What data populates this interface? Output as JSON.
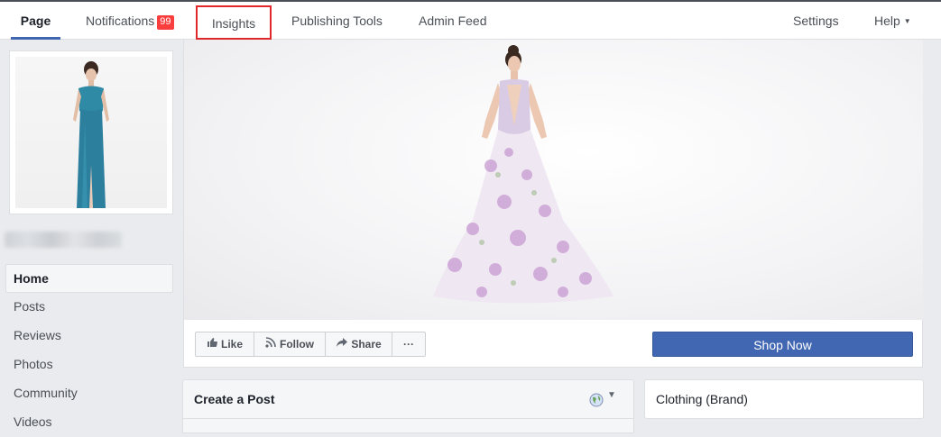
{
  "nav": {
    "page": "Page",
    "notifications": "Notifications",
    "notifications_count": "99",
    "insights": "Insights",
    "publishing_tools": "Publishing Tools",
    "admin_feed": "Admin Feed",
    "settings": "Settings",
    "help": "Help"
  },
  "sidebar": {
    "items": [
      {
        "label": "Home"
      },
      {
        "label": "Posts"
      },
      {
        "label": "Reviews"
      },
      {
        "label": "Photos"
      },
      {
        "label": "Community"
      },
      {
        "label": "Videos"
      }
    ]
  },
  "actions": {
    "like": "Like",
    "follow": "Follow",
    "share": "Share",
    "more": "···",
    "shop_now": "Shop Now"
  },
  "composer": {
    "title": "Create a Post"
  },
  "about": {
    "category": "Clothing (Brand)"
  },
  "colors": {
    "accent": "#4267b2",
    "badge": "#fa3e3e",
    "highlight_box": "#e0272b"
  }
}
